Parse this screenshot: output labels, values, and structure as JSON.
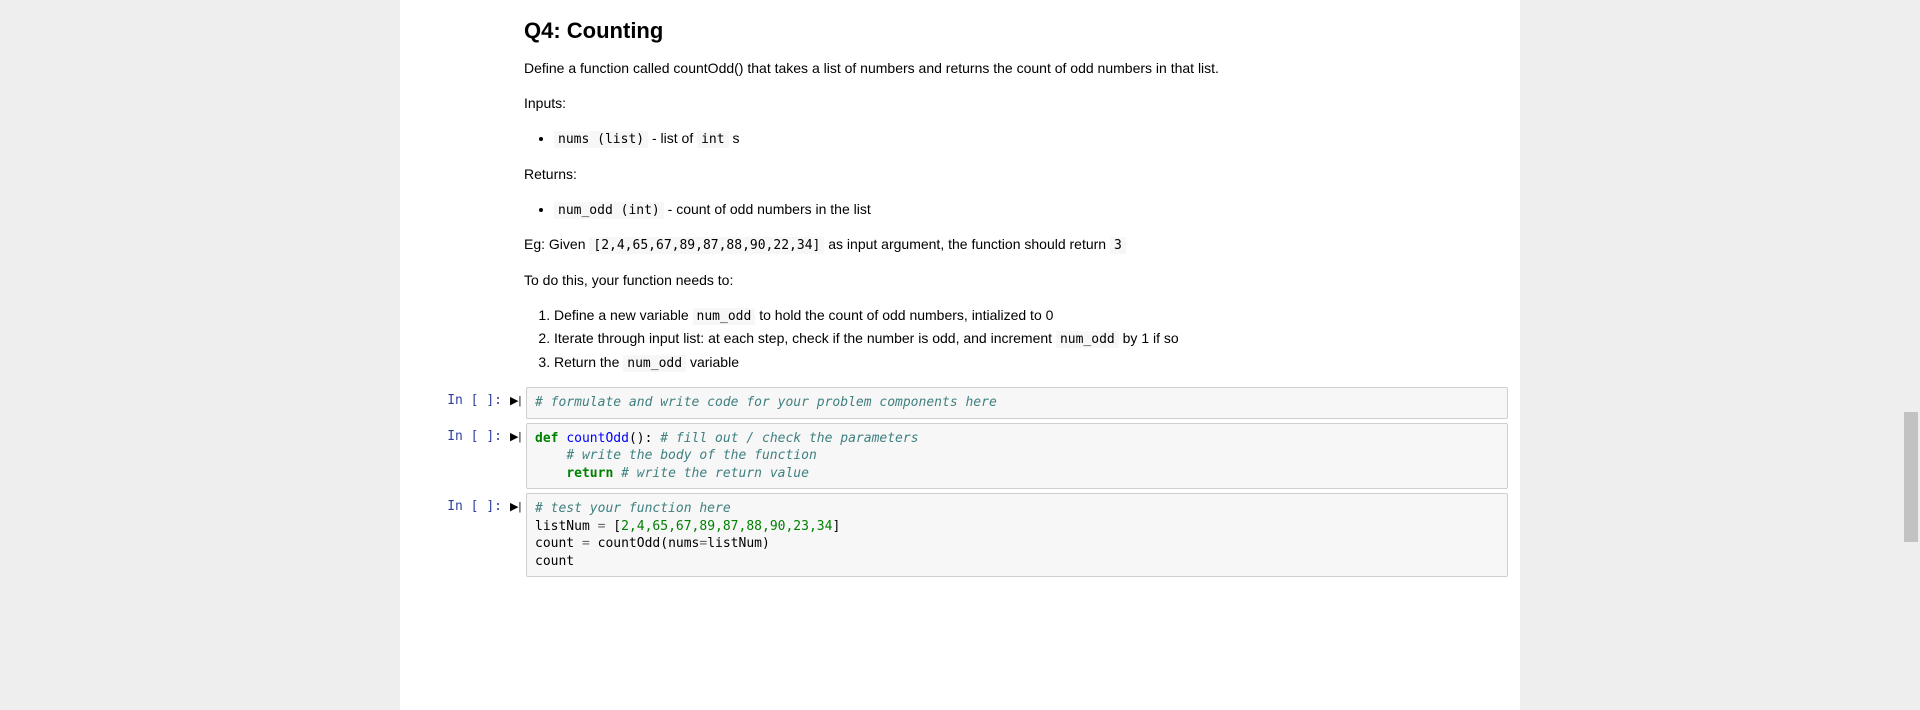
{
  "heading": "Q4: Counting",
  "intro": "Define a function called countOdd() that takes a list of numbers and returns the count of odd numbers in that list.",
  "inputs_label": "Inputs:",
  "inputs_item": {
    "code1": "nums (list)",
    "after1": " - list of ",
    "code2": "int",
    "after2": " s"
  },
  "returns_label": "Returns:",
  "returns_item": {
    "code1": "num_odd (int)",
    "after1": " - count of odd numbers in the list"
  },
  "example": {
    "before": "Eg: Given ",
    "code1": "[2,4,65,67,89,87,88,90,22,34]",
    "mid": " as input argument, the function should return ",
    "code2": "3"
  },
  "todo_label": "To do this, your function needs to:",
  "steps": {
    "s1a": "Define a new variable ",
    "s1code": "num_odd",
    "s1b": " to hold the count of odd numbers, intialized to 0",
    "s2a": "Iterate through input list: at each step, check if the number is odd, and increment ",
    "s2code": "num_odd",
    "s2b": " by 1 if so",
    "s3a": "Return the ",
    "s3code": "num_odd",
    "s3b": " variable"
  },
  "cells": {
    "prompt": "In [ ]:",
    "run_glyph": "▶|",
    "c1": {
      "comment1": "# formulate and write code for your problem components here"
    },
    "c2": {
      "kw_def": "def",
      "fname": "countOdd",
      "paren_open": "():",
      "comment1": "# fill out / check the parameters",
      "comment2": "# write the body of the function",
      "kw_return": "return",
      "comment3": "# write the return value"
    },
    "c3": {
      "comment1": "# test your function here",
      "line2a": "listNum ",
      "line2op": "=",
      "line2b": " [",
      "nums": "2,4,65,67,89,87,88,90,23,34",
      "line2c": "]",
      "line3a": "count ",
      "line3op": "=",
      "line3b": " countOdd(nums",
      "line3op2": "=",
      "line3c": "listNum)",
      "line4": "count"
    }
  }
}
